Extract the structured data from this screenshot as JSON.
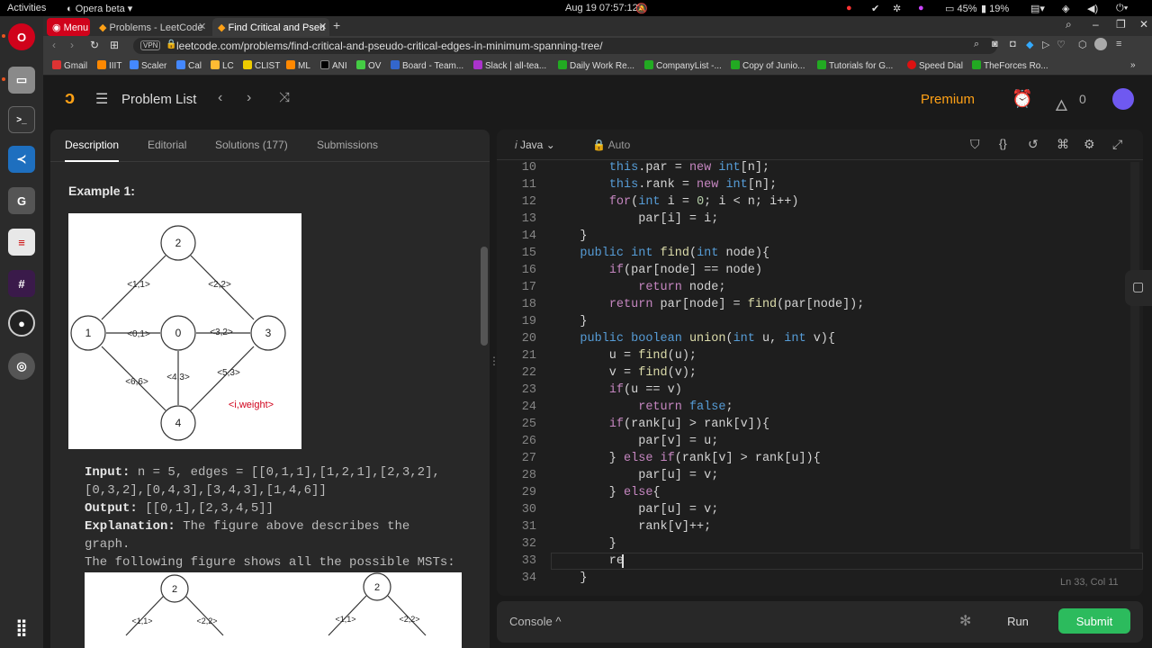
{
  "os": {
    "activities": "Activities",
    "app": "Opera beta",
    "datetime": "Aug 19  07:57:12",
    "volume": "45%",
    "battery": "19%"
  },
  "browser": {
    "tabs": [
      {
        "label": "Menu"
      },
      {
        "label": "Problems - LeetCode"
      },
      {
        "label": "Find Critical and Pseu"
      }
    ],
    "url": "leetcode.com/problems/find-critical-and-pseudo-critical-edges-in-minimum-spanning-tree/",
    "vpn": "VPN",
    "bookmarks": [
      "Gmail",
      "IIIT",
      "Scaler",
      "Cal",
      "LC",
      "CLIST",
      "ML",
      "ANI",
      "OV",
      "Board - Team...",
      "Slack | all-tea...",
      "Daily Work Re...",
      "CompanyList -...",
      "Copy of Junio...",
      "Tutorials for G...",
      "Speed Dial",
      "TheForces Ro..."
    ]
  },
  "header": {
    "problem_list": "Problem List",
    "premium": "Premium",
    "streak": "0"
  },
  "left": {
    "tabs": [
      "Description",
      "Editorial",
      "Solutions (177)",
      "Submissions"
    ],
    "example_title": "Example 1:",
    "graph": {
      "nodes": [
        "2",
        "1",
        "0",
        "3",
        "4"
      ],
      "edges": [
        "<1,1>",
        "<2,2>",
        "<0,1>",
        "<3,2>",
        "<6,6>",
        "<4,3>",
        "<5,3>"
      ],
      "legend": "<i,weight>"
    },
    "input_label": "Input:",
    "input_line1": " n = 5, edges = [[0,1,1],[1,2,1],[2,3,2],",
    "input_line2": "[0,3,2],[0,4,3],[3,4,3],[1,4,6]]",
    "output_label": "Output:",
    "output_value": " [[0,1],[2,3,4,5]]",
    "explanation_label": "Explanation:",
    "explanation_1": " The figure above describes the",
    "explanation_2": "graph.",
    "explanation_3": "The following figure shows all the possible MSTs:",
    "mst": {
      "nodes": [
        "2",
        "2"
      ],
      "edges": [
        "<1,1>",
        "<2,2>",
        "<1,1>",
        "<2,2>"
      ]
    }
  },
  "editor": {
    "language": "Java",
    "mode": "Auto",
    "status": "Ln 33, Col 11",
    "lines": [
      {
        "n": "10",
        "code": "        this.par = new int[n];"
      },
      {
        "n": "11",
        "code": "        this.rank = new int[n];"
      },
      {
        "n": "12",
        "code": "        for(int i = 0; i < n; i++)"
      },
      {
        "n": "13",
        "code": "            par[i] = i;"
      },
      {
        "n": "14",
        "code": "    }"
      },
      {
        "n": "15",
        "code": "    public int find(int node){"
      },
      {
        "n": "16",
        "code": "        if(par[node] == node)"
      },
      {
        "n": "17",
        "code": "            return node;"
      },
      {
        "n": "18",
        "code": "        return par[node] = find(par[node]);"
      },
      {
        "n": "19",
        "code": "    }"
      },
      {
        "n": "20",
        "code": "    public boolean union(int u, int v){"
      },
      {
        "n": "21",
        "code": "        u = find(u);"
      },
      {
        "n": "22",
        "code": "        v = find(v);"
      },
      {
        "n": "23",
        "code": "        if(u == v)"
      },
      {
        "n": "24",
        "code": "            return false;"
      },
      {
        "n": "25",
        "code": "        if(rank[u] > rank[v]){"
      },
      {
        "n": "26",
        "code": "            par[v] = u;"
      },
      {
        "n": "27",
        "code": "        } else if(rank[v] > rank[u]){"
      },
      {
        "n": "28",
        "code": "            par[u] = v;"
      },
      {
        "n": "29",
        "code": "        } else{"
      },
      {
        "n": "30",
        "code": "            par[u] = v;"
      },
      {
        "n": "31",
        "code": "            rank[v]++;"
      },
      {
        "n": "32",
        "code": "        }"
      },
      {
        "n": "33",
        "code": "        re"
      },
      {
        "n": "34",
        "code": "    }"
      }
    ]
  },
  "console": {
    "label": "Console",
    "run": "Run",
    "submit": "Submit"
  },
  "colors": {
    "accent": "#2cbb5d",
    "premium": "#ffa116",
    "opera": "#ff1b2d"
  }
}
